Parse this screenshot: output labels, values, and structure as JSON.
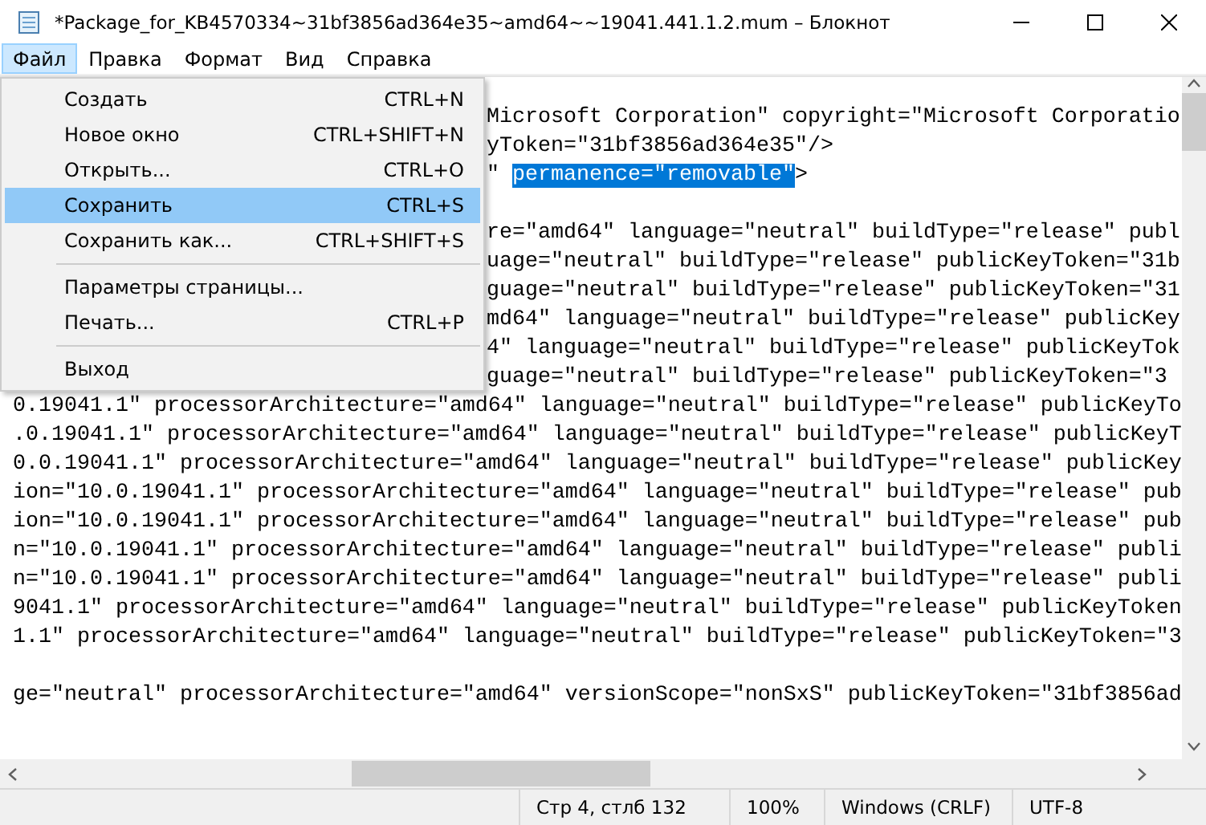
{
  "window": {
    "title": "*Package_for_KB4570334~31bf3856ad364e35~amd64~~19041.441.1.2.mum – Блокнот"
  },
  "menu_bar": [
    {
      "label": "Файл",
      "selected": true
    },
    {
      "label": "Правка",
      "selected": false
    },
    {
      "label": "Формат",
      "selected": false
    },
    {
      "label": "Вид",
      "selected": false
    },
    {
      "label": "Справка",
      "selected": false
    }
  ],
  "file_menu": [
    {
      "kind": "item",
      "label": "Создать",
      "shortcut": "CTRL+N",
      "selected": false
    },
    {
      "kind": "item",
      "label": "Новое окно",
      "shortcut": "CTRL+SHIFT+N",
      "selected": false
    },
    {
      "kind": "item",
      "label": "Открыть...",
      "shortcut": "CTRL+O",
      "selected": false
    },
    {
      "kind": "item",
      "label": "Сохранить",
      "shortcut": "CTRL+S",
      "selected": true
    },
    {
      "kind": "item",
      "label": "Сохранить как...",
      "shortcut": "CTRL+SHIFT+S",
      "selected": false
    },
    {
      "kind": "separator"
    },
    {
      "kind": "item",
      "label": "Параметры страницы...",
      "selected": false
    },
    {
      "kind": "item",
      "label": "Печать...",
      "shortcut": "CTRL+P",
      "selected": false
    },
    {
      "kind": "separator"
    },
    {
      "kind": "item",
      "label": "Выход",
      "selected": false
    }
  ],
  "editor_lines": [
    {
      "kind": "covered",
      "segments": [
        {
          "text": "Microsoft Corporation\" copyright=\"Microsoft Corporatio",
          "selected": false
        }
      ]
    },
    {
      "kind": "covered",
      "segments": [
        {
          "text": "yToken=\"31bf3856ad364e35\"/>",
          "selected": false
        }
      ]
    },
    {
      "kind": "covered",
      "segments": [
        {
          "text": "\" ",
          "selected": false
        },
        {
          "text": "permanence=\"removable\"",
          "selected": true
        },
        {
          "text": ">",
          "selected": false
        }
      ]
    },
    {
      "kind": "covered"
    },
    {
      "kind": "covered",
      "segments": [
        {
          "text": "re=\"amd64\" language=\"neutral\" buildType=\"release\" publ",
          "selected": false
        }
      ]
    },
    {
      "kind": "covered",
      "segments": [
        {
          "text": "uage=\"neutral\" buildType=\"release\" publicKeyToken=\"31b",
          "selected": false
        }
      ]
    },
    {
      "kind": "covered",
      "segments": [
        {
          "text": "guage=\"neutral\" buildType=\"release\" publicKeyToken=\"31",
          "selected": false
        }
      ]
    },
    {
      "kind": "covered",
      "segments": [
        {
          "text": "md64\" language=\"neutral\" buildType=\"release\" publicKey",
          "selected": false
        }
      ]
    },
    {
      "kind": "covered",
      "segments": [
        {
          "text": "4\" language=\"neutral\" buildType=\"release\" publicKeyTok",
          "selected": false
        }
      ]
    },
    {
      "kind": "covered",
      "segments": [
        {
          "text": "guage=\"neutral\" buildType=\"release\" publicKeyToken=\"3",
          "selected": false
        }
      ]
    },
    {
      "kind": "full",
      "segments": [
        {
          "text": "0.19041.1\" processorArchitecture=\"amd64\" language=\"neutral\" buildType=\"release\" publicKeyTo",
          "selected": false
        }
      ]
    },
    {
      "kind": "full",
      "segments": [
        {
          "text": ".0.19041.1\" processorArchitecture=\"amd64\" language=\"neutral\" buildType=\"release\" publicKeyT",
          "selected": false
        }
      ]
    },
    {
      "kind": "full",
      "segments": [
        {
          "text": "0.0.19041.1\" processorArchitecture=\"amd64\" language=\"neutral\" buildType=\"release\" publicKey",
          "selected": false
        }
      ]
    },
    {
      "kind": "full",
      "segments": [
        {
          "text": "ion=\"10.0.19041.1\" processorArchitecture=\"amd64\" language=\"neutral\" buildType=\"release\" pub",
          "selected": false
        }
      ]
    },
    {
      "kind": "full",
      "segments": [
        {
          "text": "ion=\"10.0.19041.1\" processorArchitecture=\"amd64\" language=\"neutral\" buildType=\"release\" pub",
          "selected": false
        }
      ]
    },
    {
      "kind": "full",
      "segments": [
        {
          "text": "n=\"10.0.19041.1\" processorArchitecture=\"amd64\" language=\"neutral\" buildType=\"release\" publi",
          "selected": false
        }
      ]
    },
    {
      "kind": "full",
      "segments": [
        {
          "text": "n=\"10.0.19041.1\" processorArchitecture=\"amd64\" language=\"neutral\" buildType=\"release\" publi",
          "selected": false
        }
      ]
    },
    {
      "kind": "full",
      "segments": [
        {
          "text": "9041.1\" processorArchitecture=\"amd64\" language=\"neutral\" buildType=\"release\" publicKeyToken",
          "selected": false
        }
      ]
    },
    {
      "kind": "full",
      "segments": [
        {
          "text": "1.1\" processorArchitecture=\"amd64\" language=\"neutral\" buildType=\"release\" publicKeyToken=\"3",
          "selected": false
        }
      ]
    },
    {
      "kind": "full"
    },
    {
      "kind": "full",
      "segments": [
        {
          "text": "ge=\"neutral\" processorArchitecture=\"amd64\" versionScope=\"nonSxS\" publicKeyToken=\"31bf3856ad",
          "selected": false
        }
      ]
    }
  ],
  "status_bar": [
    "Стр 4, стлб 132",
    "100%",
    "Windows (CRLF)",
    "UTF-8"
  ]
}
